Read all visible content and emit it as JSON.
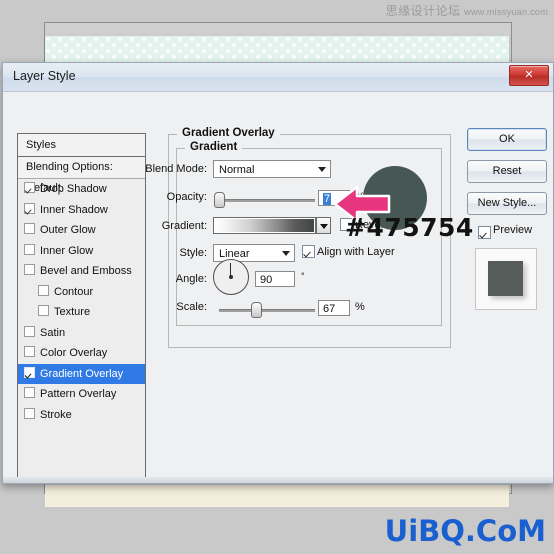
{
  "watermarks": {
    "top_cn": "思缘设计论坛",
    "top_url": "www.missyuan.com",
    "bottom": "UiBQ.CoM"
  },
  "dialog": {
    "title": "Layer Style",
    "close_label": "✕"
  },
  "styles_panel": {
    "header": "Styles",
    "blending_options": "Blending Options: Default",
    "items": [
      {
        "label": "Drop Shadow",
        "checked": true,
        "sub": false,
        "selected": false
      },
      {
        "label": "Inner Shadow",
        "checked": true,
        "sub": false,
        "selected": false
      },
      {
        "label": "Outer Glow",
        "checked": false,
        "sub": false,
        "selected": false
      },
      {
        "label": "Inner Glow",
        "checked": false,
        "sub": false,
        "selected": false
      },
      {
        "label": "Bevel and Emboss",
        "checked": false,
        "sub": false,
        "selected": false
      },
      {
        "label": "Contour",
        "checked": false,
        "sub": true,
        "selected": false
      },
      {
        "label": "Texture",
        "checked": false,
        "sub": true,
        "selected": false
      },
      {
        "label": "Satin",
        "checked": false,
        "sub": false,
        "selected": false
      },
      {
        "label": "Color Overlay",
        "checked": false,
        "sub": false,
        "selected": false
      },
      {
        "label": "Gradient Overlay",
        "checked": true,
        "sub": false,
        "selected": true
      },
      {
        "label": "Pattern Overlay",
        "checked": false,
        "sub": false,
        "selected": false
      },
      {
        "label": "Stroke",
        "checked": false,
        "sub": false,
        "selected": false
      }
    ]
  },
  "panel": {
    "group_title": "Gradient Overlay",
    "subgroup_title": "Gradient",
    "blend_mode_label": "Blend Mode:",
    "blend_mode_value": "Normal",
    "opacity_label": "Opacity:",
    "opacity_value": "7",
    "opacity_unit": "%",
    "gradient_label": "Gradient:",
    "reverse_label": "Reverse",
    "style_label": "Style:",
    "style_value": "Linear",
    "align_label": "Align with Layer",
    "angle_label": "Angle:",
    "angle_value": "90",
    "angle_unit": "°",
    "scale_label": "Scale:",
    "scale_value": "67",
    "scale_unit": "%"
  },
  "buttons": {
    "ok": "OK",
    "reset": "Reset",
    "new_style": "New Style...",
    "preview": "Preview"
  },
  "annotation": {
    "hex": "#475754",
    "swatch_color": "#475754",
    "arrow_color": "#e8357f"
  }
}
